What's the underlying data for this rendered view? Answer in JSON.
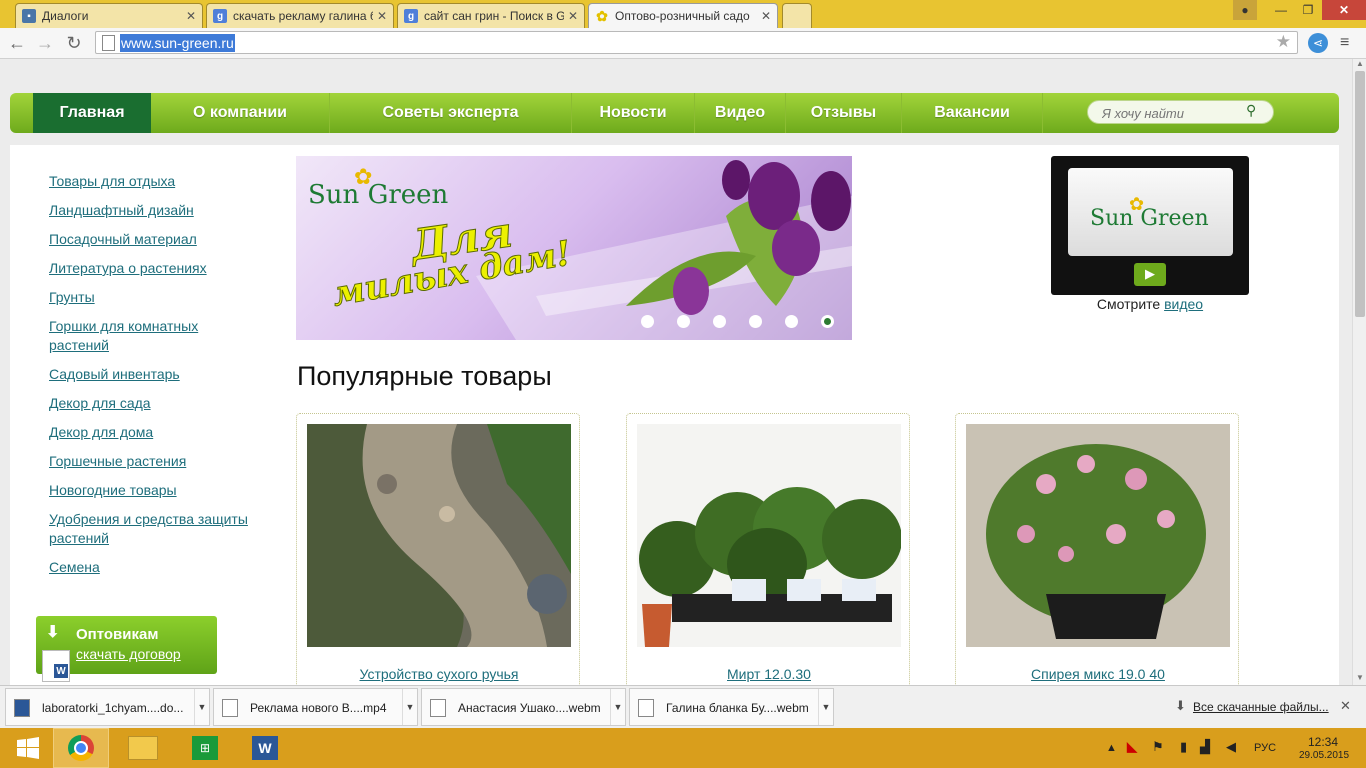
{
  "browser": {
    "tabs": [
      {
        "label": "Диалоги",
        "icon": "chat-icon"
      },
      {
        "label": "скачать рекламу галина б",
        "icon": "google-icon"
      },
      {
        "label": "сайт сан грин - Поиск в G",
        "icon": "google-icon"
      },
      {
        "label": "Оптово-розничный садо",
        "icon": "flower-icon"
      }
    ],
    "url": "www.sun-green.ru"
  },
  "nav": {
    "items": [
      "Главная",
      "О компании",
      "Советы эксперта",
      "Новости",
      "Видео",
      "Отзывы",
      "Вакансии"
    ],
    "search_placeholder": "Я хочу найти"
  },
  "sidebar": {
    "links": [
      "Товары для отдыха",
      "Ландшафтный дизайн",
      "Посадочный материал",
      "Литература о растениях",
      "Грунты",
      "Горшки для комнатных растений",
      "Садовый инвентарь",
      "Декор для сада",
      "Декор для дома",
      "Горшечные растения",
      "Новогодние товары",
      "Удобрения и средства защиты растений",
      "Семена"
    ],
    "wholesale_title": "Оптовикам",
    "wholesale_link": "скачать договор"
  },
  "banner": {
    "logo": "Sun Green",
    "headline_1": "Для",
    "headline_2": "милых дам!",
    "active_slide": 6
  },
  "video": {
    "logo": "Sun Green",
    "caption": "Смотрите",
    "caption_link": "видео"
  },
  "popular": {
    "heading": "Популярные товары",
    "items": [
      "Устройство сухого ручья",
      "Мирт 12.0.30",
      "Спирея микс 19.0 40"
    ]
  },
  "downloads": {
    "items": [
      "laboratorki_1chyam....do...",
      "Реклама нового В....mp4",
      "Анастасия Ушако....webm",
      "Галина бланка Бу....webm"
    ],
    "all_label": "Все скачанные файлы..."
  },
  "taskbar": {
    "lang": "РУС",
    "time": "12:34",
    "date": "29.05.2015"
  },
  "colors": {
    "nav_green": "#6eaa1c",
    "nav_active": "#1a6e30",
    "link": "#1e6e7c",
    "taskbar": "#d99e1c"
  }
}
